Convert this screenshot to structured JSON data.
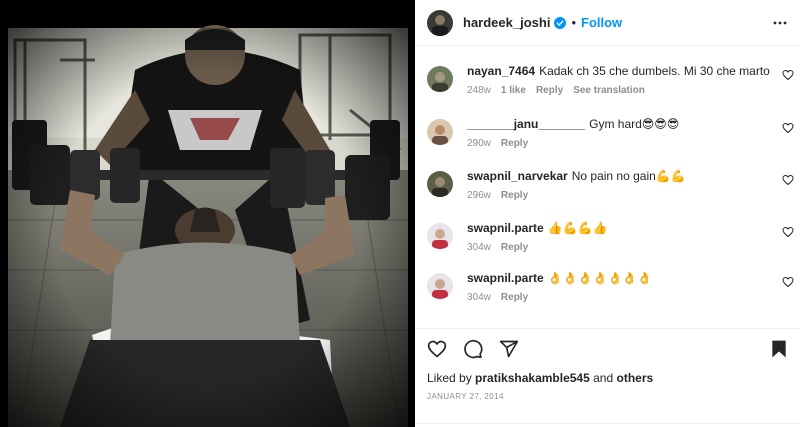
{
  "post": {
    "username": "hardeek_joshi",
    "separator": "•",
    "follow_label": "Follow",
    "more_icon": "more-options-icon",
    "verified_icon": "verified-badge-icon"
  },
  "comments": [
    {
      "username": "nayan_7464",
      "text": "Kadak ch 35 che dumbels. Mi 30 che marto",
      "time": "248w",
      "likes": "1 like",
      "reply": "Reply",
      "translate": "See translation",
      "avatar_color": "#6b7a5a"
    },
    {
      "username": "_______janu_______",
      "text": "Gym hard😎😎😎",
      "time": "290w",
      "reply": "Reply",
      "avatar_color": "#b88a6a"
    },
    {
      "username": "swapnil_narvekar",
      "text": "No pain no gain💪💪",
      "time": "296w",
      "reply": "Reply",
      "avatar_color": "#5a6048"
    },
    {
      "username": "swapnil.parte",
      "text": "👍💪💪👍",
      "time": "304w",
      "reply": "Reply",
      "avatar_color": "#c8c0c8"
    },
    {
      "username": "swapnil.parte",
      "text": "👌👌👌👌👌👌👌",
      "time": "304w",
      "reply": "Reply",
      "avatar_color": "#c8c0c8"
    }
  ],
  "actions": {
    "icons": [
      "heart-icon",
      "comment-icon",
      "share-icon",
      "save-icon"
    ]
  },
  "likes": {
    "prefix": "Liked by",
    "user": "pratikshakamble545",
    "connector": "and",
    "suffix": "others"
  },
  "date": "JANUARY 27, 2014"
}
